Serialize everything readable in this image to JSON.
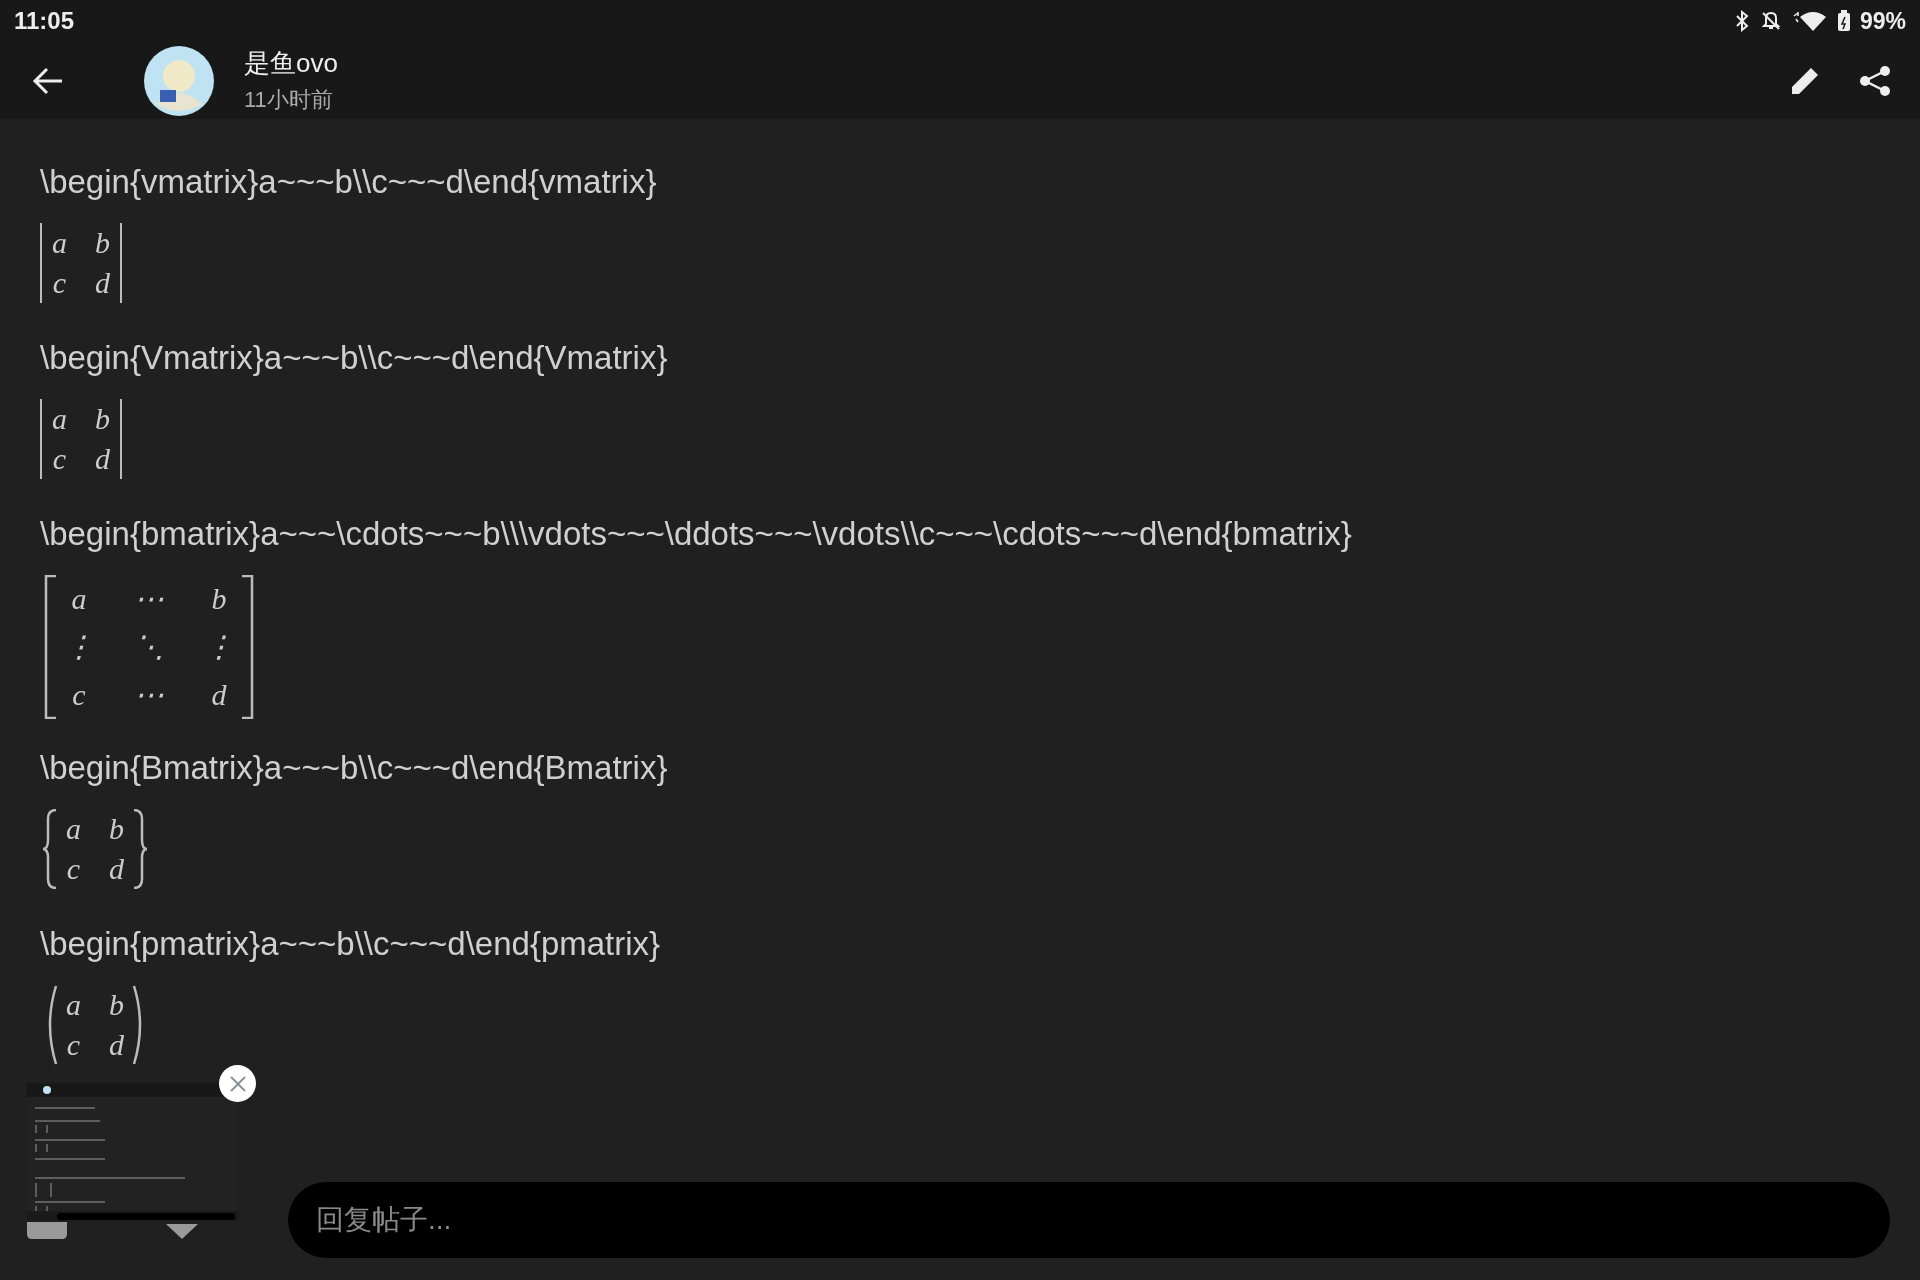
{
  "status_bar": {
    "time": "11:05",
    "battery": "99%"
  },
  "header": {
    "author": "是鱼ovo",
    "time": "11小时前"
  },
  "blocks": [
    {
      "kind": "code",
      "text": "\\begin{vmatrix}a~~~b\\\\c~~~d\\end{vmatrix}"
    },
    {
      "kind": "vert-matrix",
      "rows": [
        [
          "a",
          "b"
        ],
        [
          "c",
          "d"
        ]
      ]
    },
    {
      "kind": "code",
      "text": "\\begin{Vmatrix}a~~~b\\\\c~~~d\\end{Vmatrix}"
    },
    {
      "kind": "vert-matrix",
      "rows": [
        [
          "a",
          "b"
        ],
        [
          "c",
          "d"
        ]
      ]
    },
    {
      "kind": "code",
      "text": "\\begin{bmatrix}a~~~\\cdots~~~b\\\\\\vdots~~~\\ddots~~~\\vdots\\\\c~~~\\cdots~~~d\\end{bmatrix}"
    },
    {
      "kind": "bracket-matrix",
      "rows": [
        [
          "a",
          "⋯",
          "b"
        ],
        [
          "⋮",
          "⋱",
          "⋮"
        ],
        [
          "c",
          "⋯",
          "d"
        ]
      ]
    },
    {
      "kind": "code",
      "text": "\\begin{Bmatrix}a~~~b\\\\c~~~d\\end{Bmatrix}"
    },
    {
      "kind": "brace-matrix",
      "rows": [
        [
          "a",
          "b"
        ],
        [
          "c",
          "d"
        ]
      ]
    },
    {
      "kind": "code",
      "text": "\\begin{pmatrix}a~~~b\\\\c~~~d\\end{pmatrix}"
    },
    {
      "kind": "paren-matrix",
      "rows": [
        [
          "a",
          "b"
        ],
        [
          "c",
          "d"
        ]
      ]
    }
  ],
  "reply": {
    "placeholder": "回复帖子..."
  }
}
